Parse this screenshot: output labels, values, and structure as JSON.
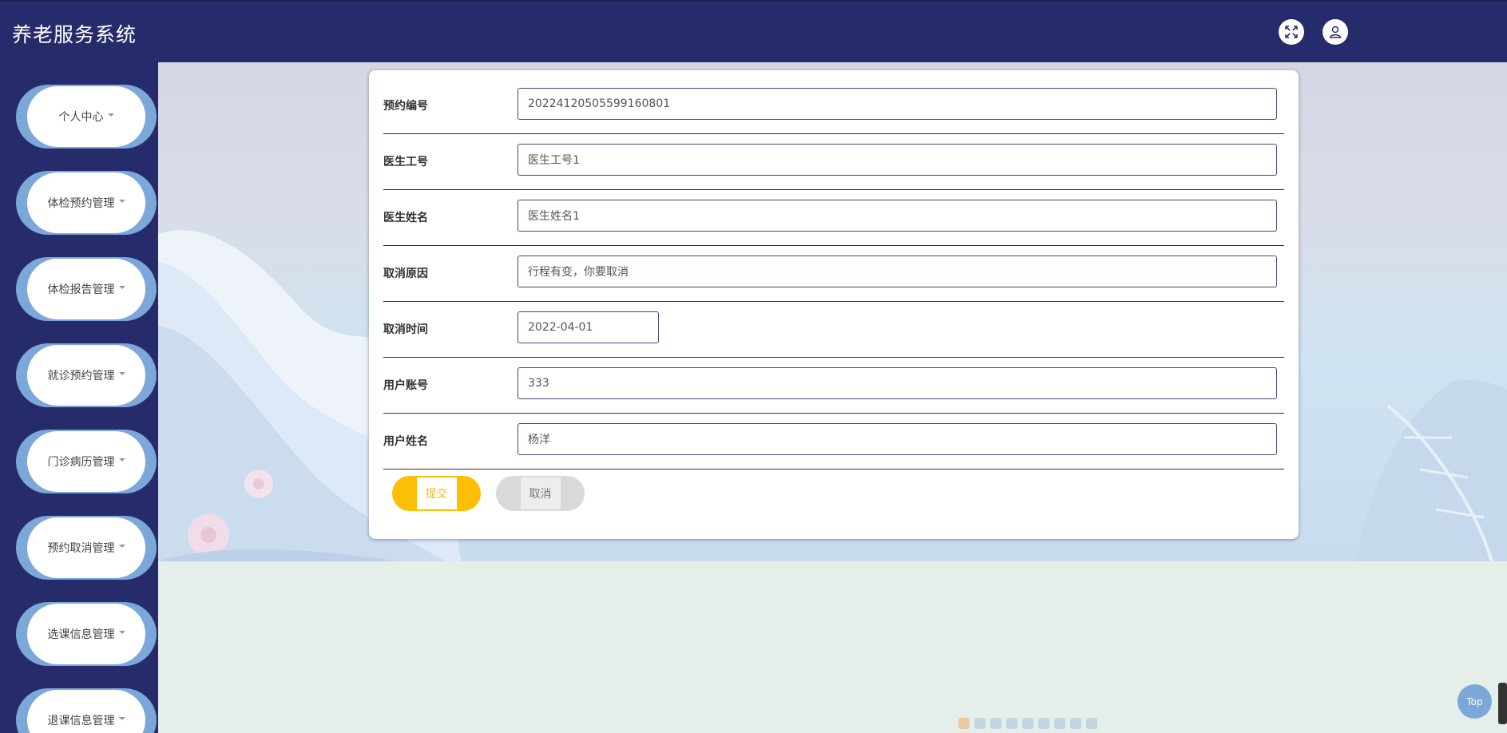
{
  "app": {
    "title": "养老服务系统"
  },
  "header": {
    "fullscreen_icon": "expand-icon",
    "user_icon": "user-icon"
  },
  "sidebar": {
    "items": [
      {
        "label": "个人中心"
      },
      {
        "label": "体检预约管理"
      },
      {
        "label": "体检报告管理"
      },
      {
        "label": "就诊预约管理"
      },
      {
        "label": "门诊病历管理"
      },
      {
        "label": "预约取消管理"
      },
      {
        "label": "选课信息管理"
      },
      {
        "label": "退课信息管理"
      }
    ]
  },
  "form": {
    "fields": [
      {
        "label": "预约编号",
        "value": "20224120505599160801"
      },
      {
        "label": "医生工号",
        "value": "医生工号1"
      },
      {
        "label": "医生姓名",
        "value": "医生姓名1"
      },
      {
        "label": "取消原因",
        "value": "行程有变，你要取消"
      },
      {
        "label": "取消时间",
        "value": "2022-04-01"
      },
      {
        "label": "用户账号",
        "value": "333"
      },
      {
        "label": "用户姓名",
        "value": "杨洋"
      }
    ],
    "submit_label": "提交",
    "cancel_label": "取消"
  },
  "back_to_top": {
    "label": "Top"
  },
  "colors": {
    "header_bg": "#262b6b",
    "accent_blue": "#7ba8d8",
    "submit_yellow": "#fcbf06",
    "cancel_gray": "#d9d9d9"
  }
}
